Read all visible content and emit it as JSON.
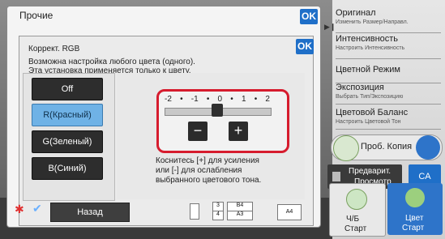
{
  "outer_dialog": {
    "title": "Прочие",
    "ok_label": "OK"
  },
  "inner_dialog": {
    "title": "Коррект. RGB",
    "ok_label": "OK",
    "description_line1": "Возможна настройка любого цвета (одного).",
    "description_line2": "Эта установка применяется только к цвету."
  },
  "color_buttons": [
    {
      "label": "Off",
      "selected": false
    },
    {
      "label": "R(Красный)",
      "selected": true
    },
    {
      "label": "G(Зеленый)",
      "selected": false
    },
    {
      "label": "B(Синий)",
      "selected": false
    }
  ],
  "slider": {
    "ticks": [
      "-2",
      "•",
      "-1",
      "•",
      "0",
      "•",
      "1",
      "•",
      "2"
    ],
    "value": 0,
    "min": -2,
    "max": 2,
    "minus_label": "−",
    "plus_label": "+"
  },
  "hint": {
    "line1": "Коснитесь [+] для усиления",
    "line2": "или [-] для ослабления",
    "line3": "выбранного цветового тона."
  },
  "sidebar": {
    "items": [
      {
        "title": "Оригинал",
        "subtitle": "Изменить Размер/Направл."
      },
      {
        "title": "Интенсивность",
        "subtitle": "Настроить Интенсивность"
      },
      {
        "title": "Цветной Режим",
        "subtitle": ""
      },
      {
        "title": "Экспозиция",
        "subtitle": "Выбрать Тип/Экспозицию"
      },
      {
        "title": "Цветовой Баланс",
        "subtitle": "Настроить Цветовой Тон"
      }
    ],
    "proof_copy": "Проб. Копия",
    "preview_line1": "Предварит.",
    "preview_line2": "Просмотр",
    "ca": "CA",
    "bw_line1": "Ч/Б",
    "bw_line2": "Старт",
    "color_line1": "Цвет",
    "color_line2": "Старт"
  },
  "bottom": {
    "back_label": "Назад",
    "paper_1": "3",
    "paper_2": "4",
    "paper_b4": "B4",
    "paper_a3": "A3",
    "paper_a4": "A4"
  },
  "colors": {
    "accent": "#1f6fc8",
    "highlight": "#d61c2e",
    "selected": "#6fb2e6"
  }
}
